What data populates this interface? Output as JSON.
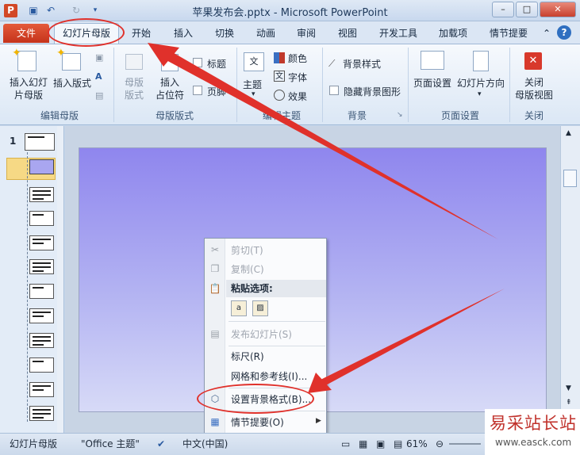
{
  "window": {
    "title": "苹果发布会.pptx - Microsoft PowerPoint",
    "app_icon": "P"
  },
  "window_controls": {
    "minimize": "–",
    "maximize": "□",
    "close": "✕"
  },
  "tabs": [
    "文件",
    "幻灯片母版",
    "开始",
    "插入",
    "切换",
    "动画",
    "审阅",
    "视图",
    "开发工具",
    "加载项",
    "情节提要"
  ],
  "ribbon": {
    "edit_master": {
      "insert_slide_master": "插入幻灯\n片母版",
      "insert_layout": "插入版式",
      "group": "编辑母版"
    },
    "master_layout": {
      "master_layout_btn": "母版\n版式",
      "insert_placeholder": "插入\n占位符",
      "title_check": "标题",
      "footer_check": "页脚",
      "group": "母版版式"
    },
    "edit_theme": {
      "themes": "主题",
      "colors": "颜色",
      "fonts": "字体",
      "effects": "效果",
      "group": "编辑主题"
    },
    "background": {
      "bg_styles": "背景样式",
      "hide_bg_graphics": "隐藏背景图形",
      "group": "背景"
    },
    "page_setup": {
      "page_setup_btn": "页面设置",
      "orientation": "幻灯片方向",
      "group": "页面设置"
    },
    "close": {
      "close_master": "关闭\n母版视图",
      "group": "关闭"
    }
  },
  "thumbnails": {
    "number": "1",
    "count": 12
  },
  "context_menu": {
    "cut": "剪切(T)",
    "copy": "复制(C)",
    "paste_options": "粘贴选项:",
    "publish": "发布幻灯片(S)",
    "ruler": "标尺(R)",
    "grid": "网格和参考线(I)...",
    "format_bg": "设置背景格式(B)...",
    "storyboard": "情节提要(O)"
  },
  "statusbar": {
    "view": "幻灯片母版",
    "theme": "\"Office 主题\"",
    "language": "中文(中国)",
    "zoom": "61%"
  },
  "watermark": {
    "cn": "易采站长站",
    "url": "www.easck.com"
  },
  "colors": {
    "file_tab": "#d24726",
    "annotation": "#e0312b",
    "slide_top": "#8f86ee",
    "slide_bottom": "#d7daf7"
  }
}
